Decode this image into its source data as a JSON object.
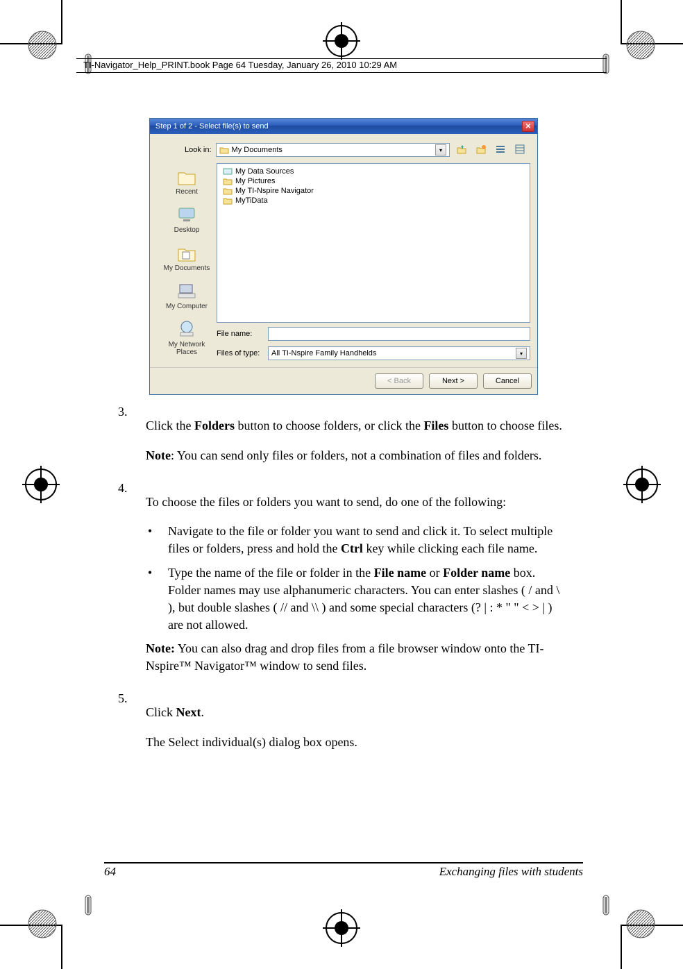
{
  "header": {
    "running": "TI-Navigator_Help_PRINT.book  Page 64  Tuesday, January 26, 2010  10:29 AM"
  },
  "dialog": {
    "title": "Step 1 of 2 - Select file(s) to send",
    "lookin_label": "Look in:",
    "lookin_value": "My Documents",
    "places": {
      "recent": "Recent",
      "desktop": "Desktop",
      "mydocs": "My Documents",
      "mycomp": "My Computer",
      "mynet_l1": "My Network",
      "mynet_l2": "Places"
    },
    "files": {
      "f1": "My Data Sources",
      "f2": "My Pictures",
      "f3": "My TI-Nspire Navigator",
      "f4": "MyTiData"
    },
    "filename_label": "File name:",
    "filename_value": "",
    "filetype_label": "Files of type:",
    "filetype_value": "All TI-Nspire Family Handhelds",
    "buttons": {
      "back": "< Back",
      "next": "Next >",
      "cancel": "Cancel"
    }
  },
  "steps": {
    "s3_num": "3.",
    "s3_pre": "Click the ",
    "s3_folders": "Folders",
    "s3_mid": " button to choose folders, or click the ",
    "s3_files": "Files",
    "s3_post": " button to choose files.",
    "s3_note_b": "Note",
    "s3_note_rest": ": You can send only files or folders, not a combination of files and folders.",
    "s4_num": "4.",
    "s4_text": "To choose the files or folders you want to send, do one of the following:",
    "b1_pre": "Navigate to the file or folder you want to send and click it. To select multiple files or folders, press and hold the ",
    "b1_ctrl": "Ctrl",
    "b1_post": " key while clicking each file name.",
    "b2_pre": "Type the name of the file or folder in the ",
    "b2_fn": "File name",
    "b2_or": " or ",
    "b2_fldn": "Folder name",
    "b2_rest": " box. Folder names may use alphanumeric characters. You can enter slashes ( / and \\ ), but double slashes ( // and \\\\ ) and some special characters (? | : * \"  \" < > | ) are not allowed.",
    "s4_note_b": "Note:",
    "s4_note_rest": " You can also drag and drop files from a file browser window onto the TI-Nspire™ Navigator™ window to send files.",
    "s5_num": "5.",
    "s5_pre": "Click ",
    "s5_next": "Next",
    "s5_post": ".",
    "s5_after": "The Select individual(s) dialog box opens."
  },
  "footer": {
    "page": "64",
    "title": "Exchanging files with students"
  }
}
